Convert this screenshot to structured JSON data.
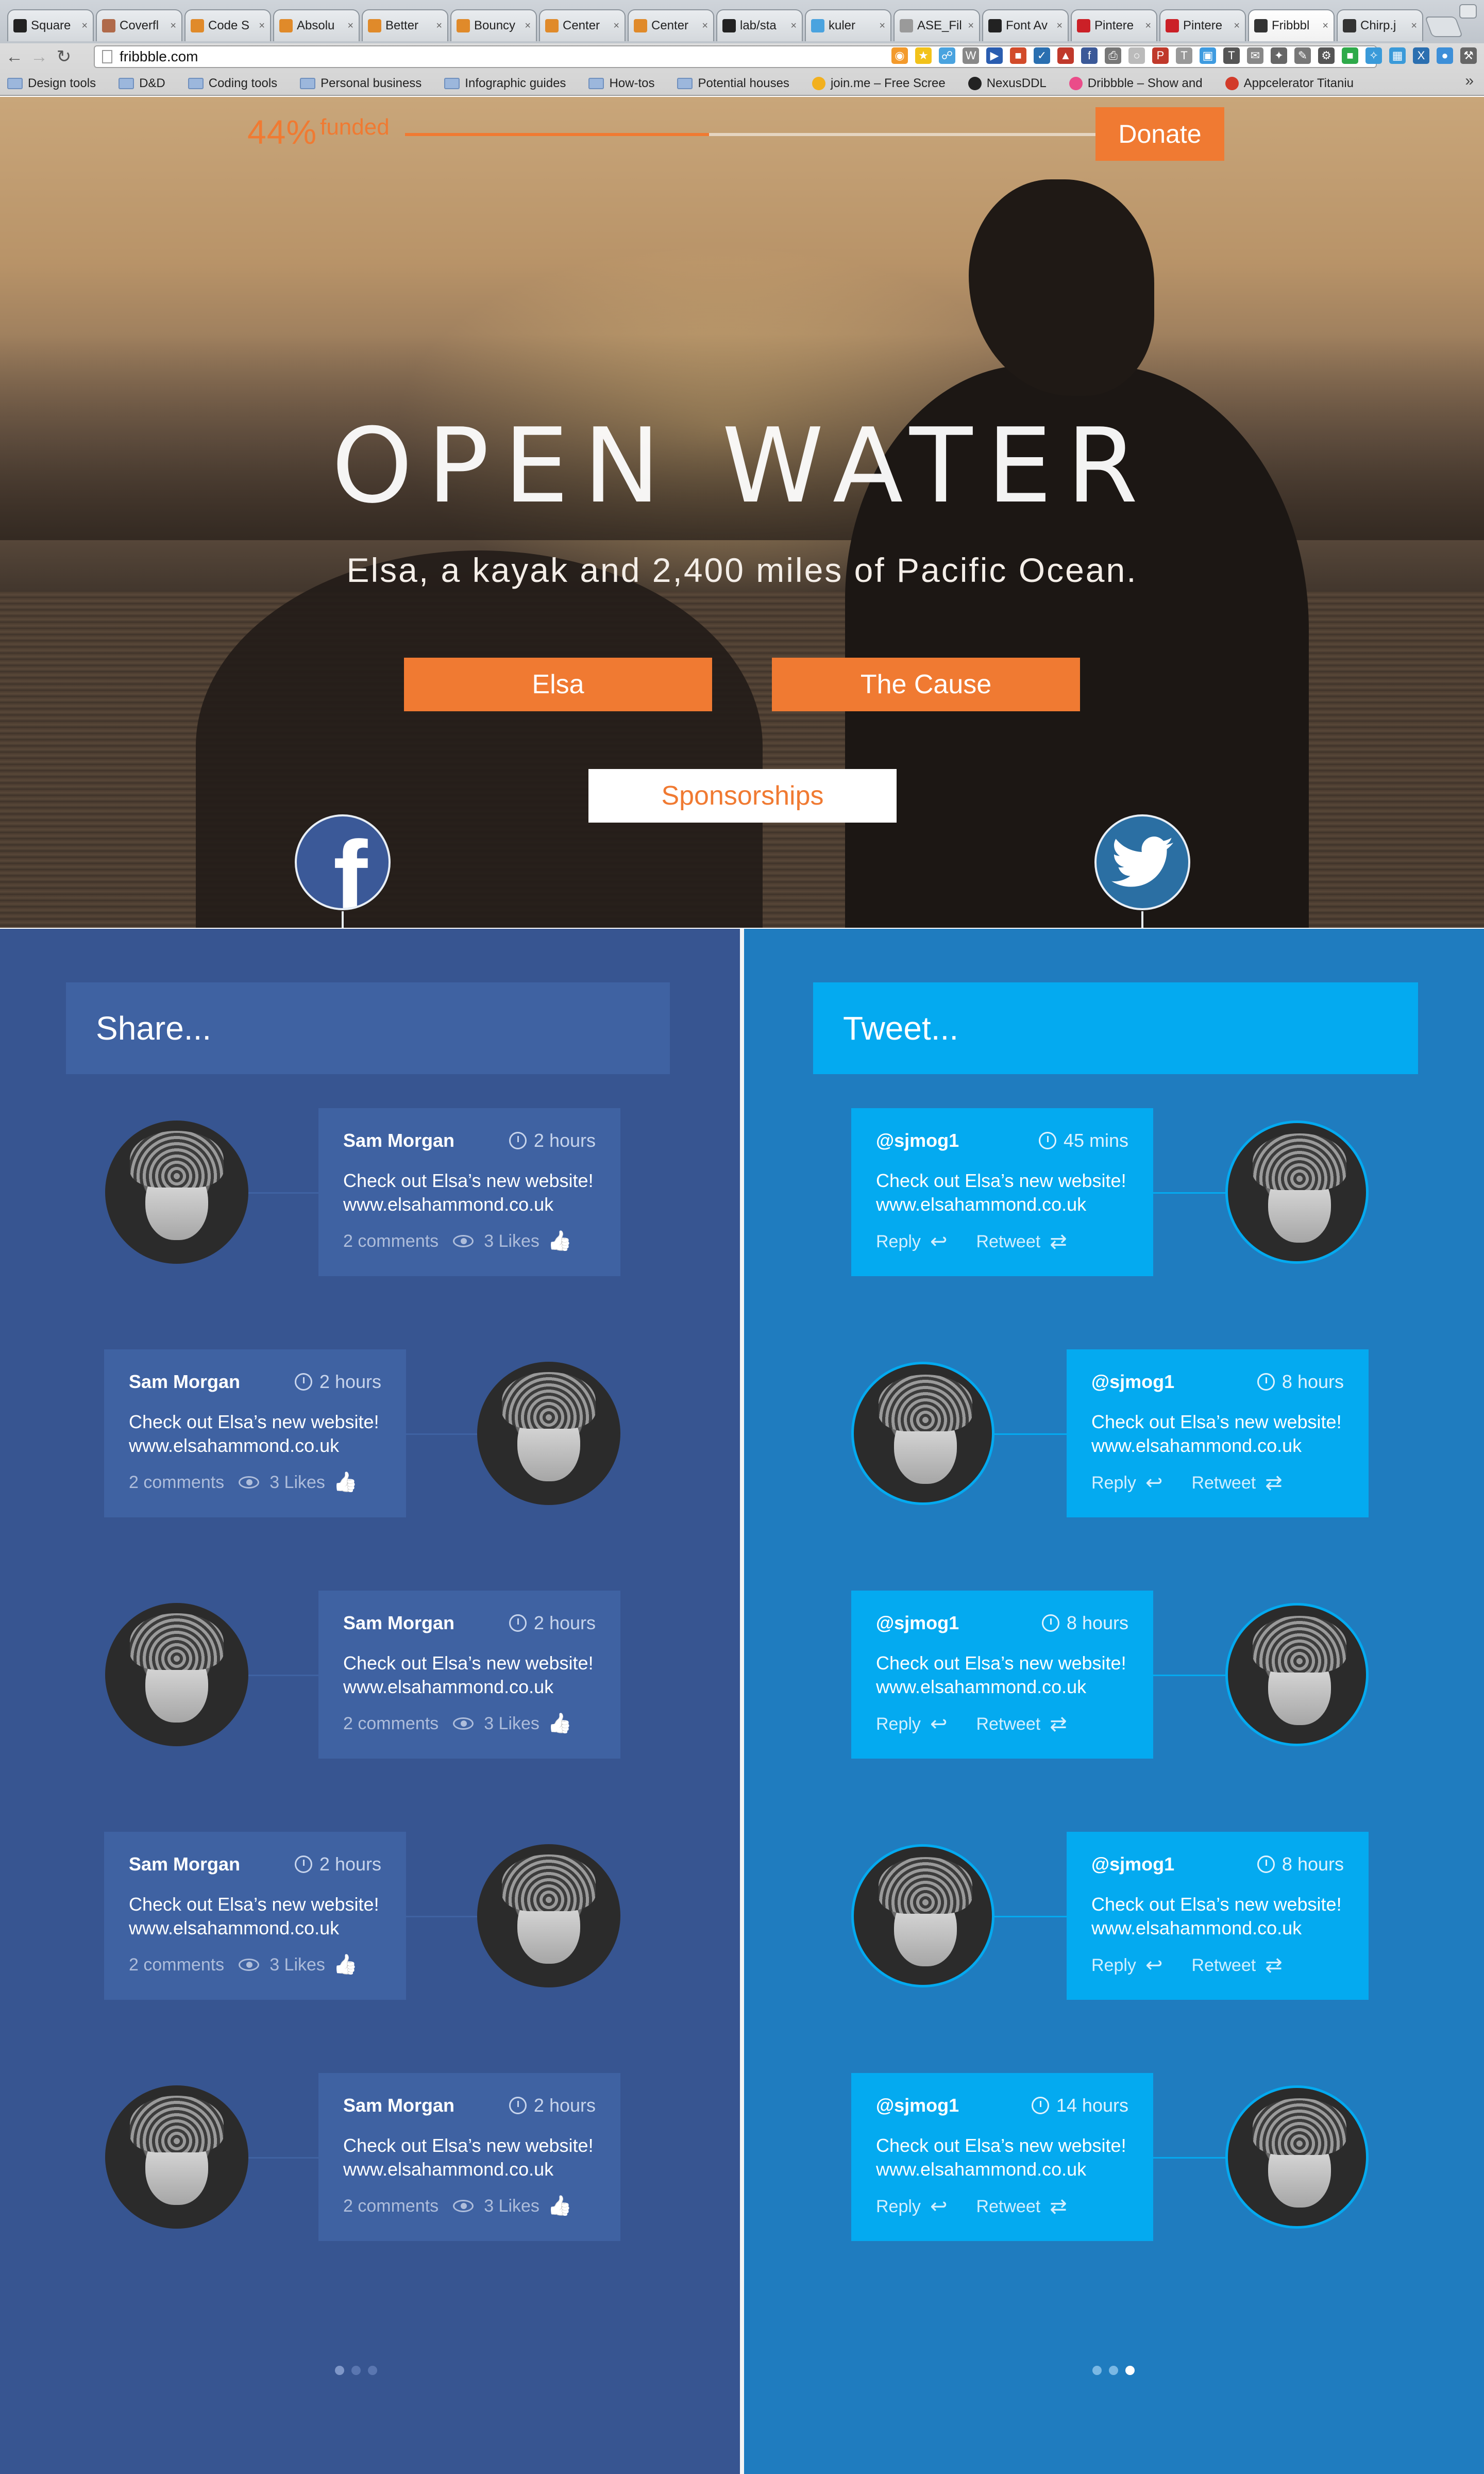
{
  "browser": {
    "tabs": [
      {
        "label": "Square",
        "icon": "h-icon",
        "color": "#222222"
      },
      {
        "label": "Coverfl",
        "icon": "avatar-icon",
        "color": "#b06a4a"
      },
      {
        "label": "Code S",
        "icon": "asterisk-icon",
        "color": "#e08a2a"
      },
      {
        "label": "Absolu",
        "icon": "asterisk-icon",
        "color": "#e08a2a"
      },
      {
        "label": "Better",
        "icon": "asterisk-icon",
        "color": "#e08a2a"
      },
      {
        "label": "Bouncy",
        "icon": "asterisk-icon",
        "color": "#e08a2a"
      },
      {
        "label": "Center",
        "icon": "asterisk-icon",
        "color": "#e08a2a"
      },
      {
        "label": "Center",
        "icon": "asterisk-icon",
        "color": "#e08a2a"
      },
      {
        "label": "lab/sta",
        "icon": "github-icon",
        "color": "#222222"
      },
      {
        "label": "kuler",
        "icon": "kuler-icon",
        "color": "#4aa3df"
      },
      {
        "label": "ASE_Fil",
        "icon": "page-icon",
        "color": "#9a9a9a"
      },
      {
        "label": "Font Av",
        "icon": "flag-icon",
        "color": "#222222"
      },
      {
        "label": "Pintere",
        "icon": "pinterest-icon",
        "color": "#cb2027"
      },
      {
        "label": "Pintere",
        "icon": "pinterest-icon",
        "color": "#cb2027"
      },
      {
        "label": "Fribbbl",
        "icon": "f-icon",
        "color": "#333333",
        "active": true
      },
      {
        "label": "Chirp.j",
        "icon": "f-icon",
        "color": "#333333"
      }
    ],
    "url": "fribbble.com",
    "bookmarks": [
      {
        "label": "Design tools",
        "type": "folder"
      },
      {
        "label": "D&D",
        "type": "folder"
      },
      {
        "label": "Coding tools",
        "type": "folder"
      },
      {
        "label": "Personal business",
        "type": "folder"
      },
      {
        "label": "Infographic guides",
        "type": "folder"
      },
      {
        "label": "How-tos",
        "type": "folder"
      },
      {
        "label": "Potential houses",
        "type": "folder"
      },
      {
        "label": "join.me – Free Scree",
        "type": "site",
        "color": "#f2b01e"
      },
      {
        "label": "NexusDDL",
        "type": "site",
        "color": "#222222"
      },
      {
        "label": "Dribbble – Show and",
        "type": "site",
        "color": "#ea4c89"
      },
      {
        "label": "Appcelerator Titaniu",
        "type": "site",
        "color": "#d23b2a"
      }
    ]
  },
  "hero": {
    "funded_percent": "44%",
    "funded_word": "funded",
    "progress_fraction": 0.44,
    "donate_label": "Donate",
    "title": "OPEN WATER",
    "subtitle": "Elsa, a kayak and 2,400 miles of Pacific Ocean.",
    "buttons": {
      "elsa": "Elsa",
      "cause": "The Cause",
      "sponsorships": "Sponsorships"
    }
  },
  "share": {
    "header": "Share...",
    "posts": [
      {
        "name": "Sam Morgan",
        "time": "2 hours",
        "text1": "Check out Elsa’s new website!",
        "text2": "www.elsahammond.co.uk",
        "comments": "2 comments",
        "likes": "3 Likes"
      },
      {
        "name": "Sam Morgan",
        "time": "2 hours",
        "text1": "Check out Elsa’s new website!",
        "text2": "www.elsahammond.co.uk",
        "comments": "2 comments",
        "likes": "3 Likes"
      },
      {
        "name": "Sam Morgan",
        "time": "2 hours",
        "text1": "Check out Elsa’s new website!",
        "text2": "www.elsahammond.co.uk",
        "comments": "2 comments",
        "likes": "3 Likes"
      },
      {
        "name": "Sam Morgan",
        "time": "2 hours",
        "text1": "Check out Elsa’s new website!",
        "text2": "www.elsahammond.co.uk",
        "comments": "2 comments",
        "likes": "3 Likes"
      },
      {
        "name": "Sam Morgan",
        "time": "2 hours",
        "text1": "Check out Elsa’s new website!",
        "text2": "www.elsahammond.co.uk",
        "comments": "2 comments",
        "likes": "3 Likes"
      }
    ],
    "dots_active_index": 0
  },
  "tweet": {
    "header": "Tweet...",
    "posts": [
      {
        "handle": "@sjmog1",
        "time": "45 mins",
        "text1": "Check out Elsa’s new website!",
        "text2": "www.elsahammond.co.uk",
        "reply": "Reply",
        "retweet": "Retweet"
      },
      {
        "handle": "@sjmog1",
        "time": "8 hours",
        "text1": "Check out Elsa’s new website!",
        "text2": "www.elsahammond.co.uk",
        "reply": "Reply",
        "retweet": "Retweet"
      },
      {
        "handle": "@sjmog1",
        "time": "8 hours",
        "text1": "Check out Elsa’s new website!",
        "text2": "www.elsahammond.co.uk",
        "reply": "Reply",
        "retweet": "Retweet"
      },
      {
        "handle": "@sjmog1",
        "time": "8 hours",
        "text1": "Check out Elsa’s new website!",
        "text2": "www.elsahammond.co.uk",
        "reply": "Reply",
        "retweet": "Retweet"
      },
      {
        "handle": "@sjmog1",
        "time": "14 hours",
        "text1": "Check out Elsa’s new website!",
        "text2": "www.elsahammond.co.uk",
        "reply": "Reply",
        "retweet": "Retweet"
      }
    ],
    "dots_active_index": 2
  },
  "colors": {
    "accent": "#f07a32",
    "facebook_panel": "#375591",
    "facebook_card": "#3f62a2",
    "twitter_panel": "#1f7cbf",
    "twitter_card": "#04aaf0"
  }
}
